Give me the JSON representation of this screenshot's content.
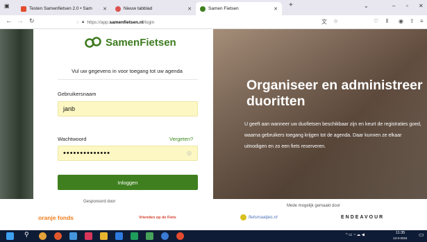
{
  "browser": {
    "tabs": [
      {
        "label": "Testen Samenfietsen 2.0 • Sam",
        "active": false
      },
      {
        "label": "Nieuw tabblad",
        "active": false
      },
      {
        "label": "Samen Fietsen",
        "active": true
      }
    ],
    "new_tab": "+",
    "url_prefix": "https://app.",
    "url_domain": "samenfietsen.nl",
    "url_suffix": "/login"
  },
  "login": {
    "brand": "SamenFietsen",
    "intro": "Vul uw gegevens in voor toegang tot uw agenda",
    "username_label": "Gebruikersnaam",
    "username_value": "janb",
    "password_label": "Wachtwoord",
    "forgot_link": "Vergeten?",
    "password_mask": "••••••••••••••",
    "submit_label": "Inloggen"
  },
  "hero": {
    "heading": "Organiseer en administreer duoritten",
    "text": "U geeft aan wanneer uw duofietsen beschikbaar zijn en keurt de registraties goed, waarna gebruikers toegang krijgen tot de agenda. Daar kunnen ze elkaar uitnodigen en zo een fiets reserveren."
  },
  "sponsors": {
    "left_label": "Gesponsord door",
    "right_label": "Mede mogelijk gemaakt door",
    "logos": [
      "oranje fonds",
      "Vrienden op de Fiets",
      "fietsmaatjes.nl",
      "ENDEAVOUR"
    ]
  },
  "taskbar": {
    "time": "11:35",
    "date": "13-3-2024"
  },
  "colors": {
    "brand_green": "#3f7f1f",
    "field_yellow": "#fdf7c3",
    "taskbar": "#0f1c36"
  }
}
